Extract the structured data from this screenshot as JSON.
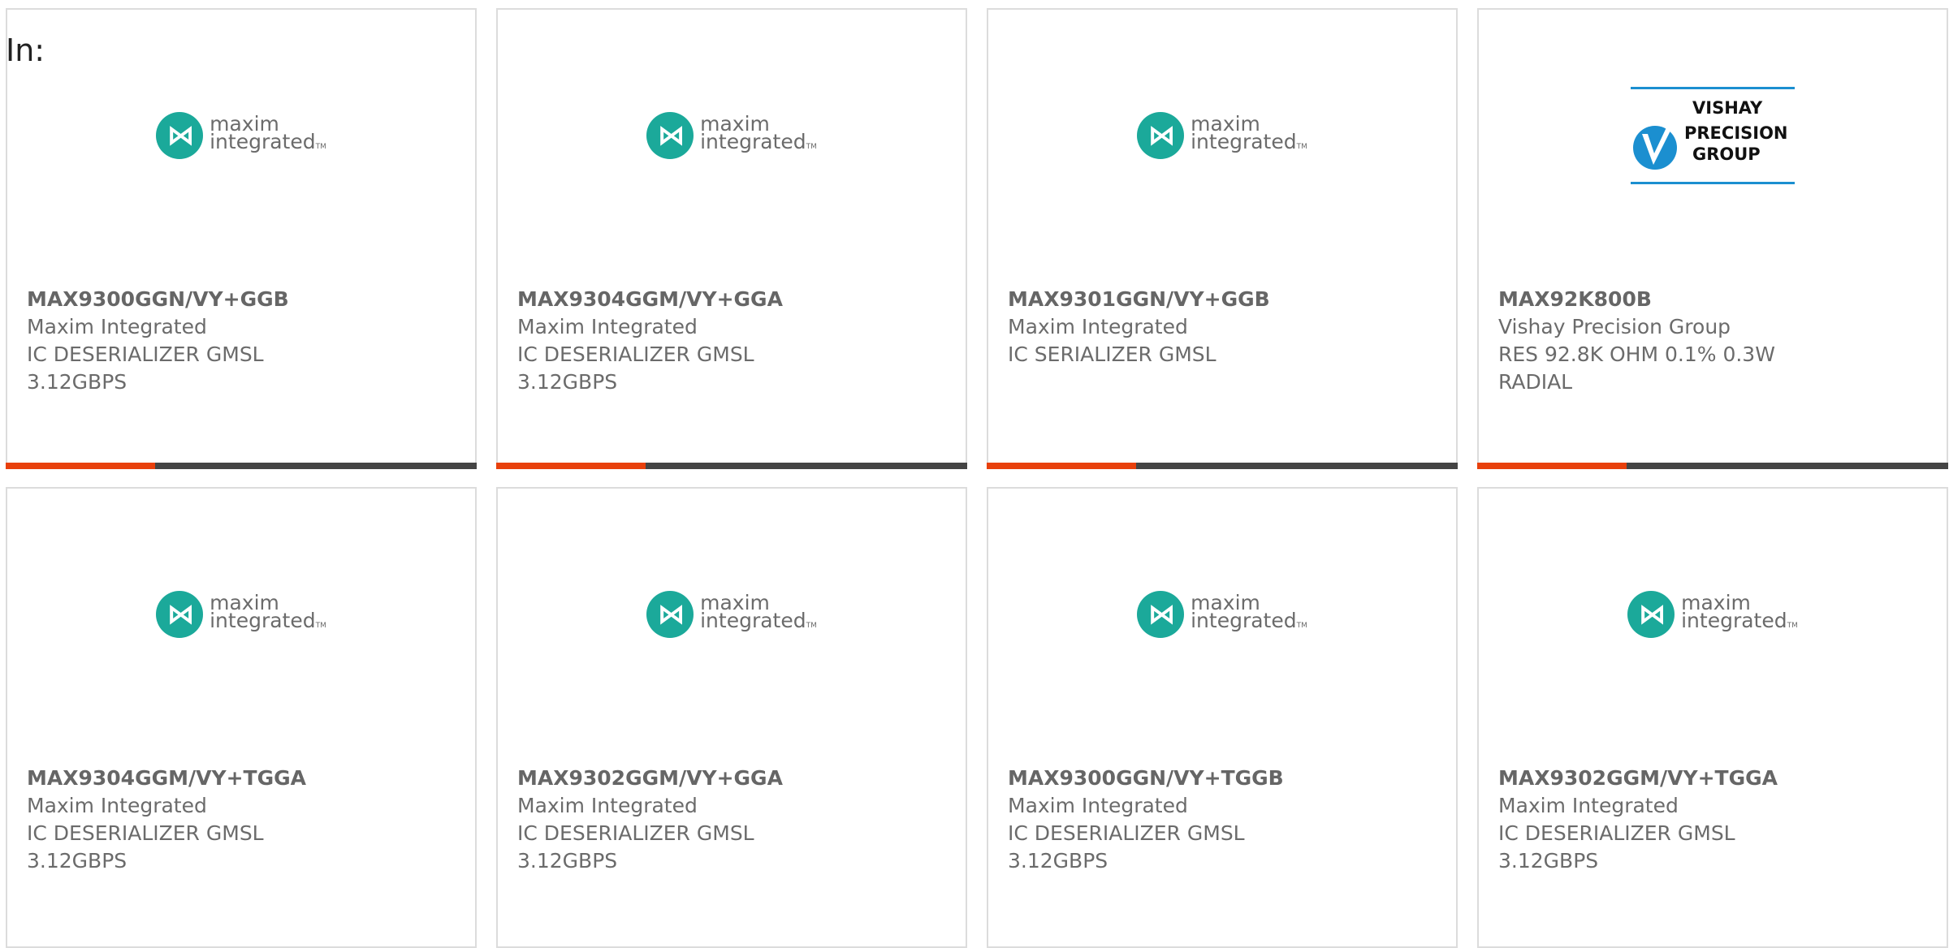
{
  "header": {
    "in_label": "In:"
  },
  "maxim_logo": {
    "line1": "maxim",
    "line2": "integrated",
    "tm": "TM"
  },
  "vishay_logo": {
    "line1": "VISHAY",
    "line2": "PRECISION",
    "line3": "GROUP"
  },
  "colors": {
    "accent": "#e8400c",
    "bar": "#444444",
    "maxim_teal": "#1ba99a",
    "vishay_blue": "#1b8fd0"
  },
  "products": [
    {
      "part": "MAX9300GGN/VY+GGB",
      "manufacturer": "Maxim Integrated",
      "desc_line1": "IC DESERIALIZER GMSL",
      "desc_line2": "3.12GBPS",
      "logo": "maxim"
    },
    {
      "part": "MAX9304GGM/VY+GGA",
      "manufacturer": "Maxim Integrated",
      "desc_line1": "IC DESERIALIZER GMSL",
      "desc_line2": "3.12GBPS",
      "logo": "maxim"
    },
    {
      "part": "MAX9301GGN/VY+GGB",
      "manufacturer": "Maxim Integrated",
      "desc_line1": "IC SERIALIZER GMSL",
      "desc_line2": "",
      "logo": "maxim"
    },
    {
      "part": "MAX92K800B",
      "manufacturer": "Vishay Precision Group",
      "desc_line1": "RES 92.8K OHM 0.1% 0.3W",
      "desc_line2": "RADIAL",
      "logo": "vishay"
    },
    {
      "part": "MAX9304GGM/VY+TGGA",
      "manufacturer": "Maxim Integrated",
      "desc_line1": "IC DESERIALIZER GMSL",
      "desc_line2": "3.12GBPS",
      "logo": "maxim"
    },
    {
      "part": "MAX9302GGM/VY+GGA",
      "manufacturer": "Maxim Integrated",
      "desc_line1": "IC DESERIALIZER GMSL",
      "desc_line2": "3.12GBPS",
      "logo": "maxim"
    },
    {
      "part": "MAX9300GGN/VY+TGGB",
      "manufacturer": "Maxim Integrated",
      "desc_line1": "IC DESERIALIZER GMSL",
      "desc_line2": "3.12GBPS",
      "logo": "maxim"
    },
    {
      "part": "MAX9302GGM/VY+TGGA",
      "manufacturer": "Maxim Integrated",
      "desc_line1": "IC DESERIALIZER GMSL",
      "desc_line2": "3.12GBPS",
      "logo": "maxim"
    }
  ]
}
